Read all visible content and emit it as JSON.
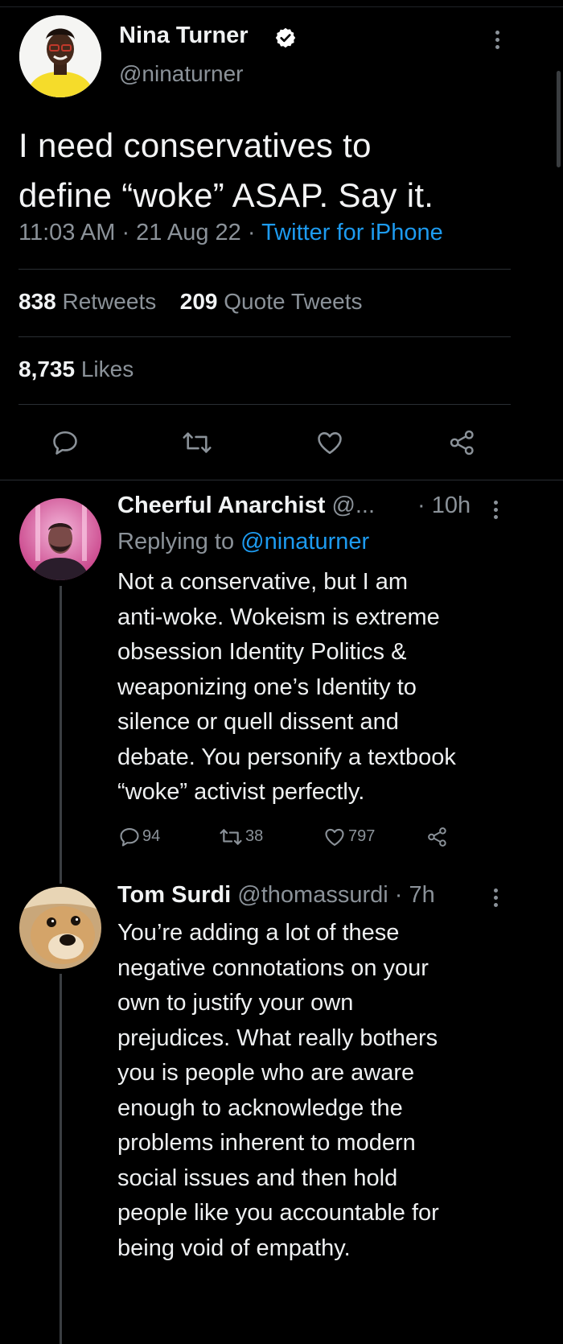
{
  "main_tweet": {
    "author_name": "Nina Turner",
    "handle": "@ninaturner",
    "text": "I need conservatives to\ndefine “woke” ASAP. Say it.",
    "time": "11:03 AM",
    "date": "21 Aug 22",
    "source": "Twitter for iPhone",
    "retweets_count": "838",
    "retweets_label": "Retweets",
    "quotes_count": "209",
    "quotes_label": "Quote Tweets",
    "likes_count": "8,735",
    "likes_label": "Likes"
  },
  "replies": [
    {
      "author_name": "Cheerful Anarchist",
      "handle": "@...",
      "time": "· 10h",
      "replying_prefix": "Replying to",
      "replying_handle": "@ninaturner",
      "text": "Not a conservative, but I am\nanti-woke. Wokeism is extreme\nobsession Identity Politics &\nweaponizing one’s Identity to\nsilence or quell dissent and\ndebate. You personify a textbook\n“woke” activist perfectly.",
      "reply_count": "94",
      "retweet_count": "38",
      "like_count": "797"
    },
    {
      "author_name": "Tom Surdi",
      "handle": "@thomassurdi",
      "time": "· 7h",
      "text": "You’re adding a lot of these\nnegative connotations on your\nown to justify your own\nprejudices.  What really bothers\nyou is people who are aware\nenough to acknowledge the\nproblems inherent to modern\nsocial issues and then hold\npeople like you accountable for\nbeing void of empathy."
    }
  ],
  "colors": {
    "background": "#000000",
    "text": "#e7e9ea",
    "secondary": "#8b9299",
    "link": "#1d9bf0",
    "divider": "#2a2e33"
  },
  "icons": [
    "verified-badge-icon",
    "more-icon",
    "reply-icon",
    "retweet-icon",
    "like-icon",
    "share-icon"
  ]
}
